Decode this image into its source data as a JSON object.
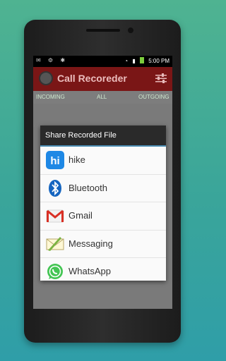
{
  "status_bar": {
    "time": "5:00 PM"
  },
  "app": {
    "title": "Call Recoreder"
  },
  "tabs": [
    "INCOMING",
    "ALL",
    "OUTGOING"
  ],
  "dialog": {
    "title": "Share Recorded File",
    "options": [
      {
        "label": "hike",
        "icon": "hike-icon"
      },
      {
        "label": "Bluetooth",
        "icon": "bluetooth-icon"
      },
      {
        "label": "Gmail",
        "icon": "gmail-icon"
      },
      {
        "label": "Messaging",
        "icon": "messaging-icon"
      },
      {
        "label": "WhatsApp",
        "icon": "whatsapp-icon"
      }
    ]
  },
  "colors": {
    "app_bar": "#7a1616",
    "dialog_header": "#2a2a2a",
    "accent_line": "#4b8db3"
  }
}
